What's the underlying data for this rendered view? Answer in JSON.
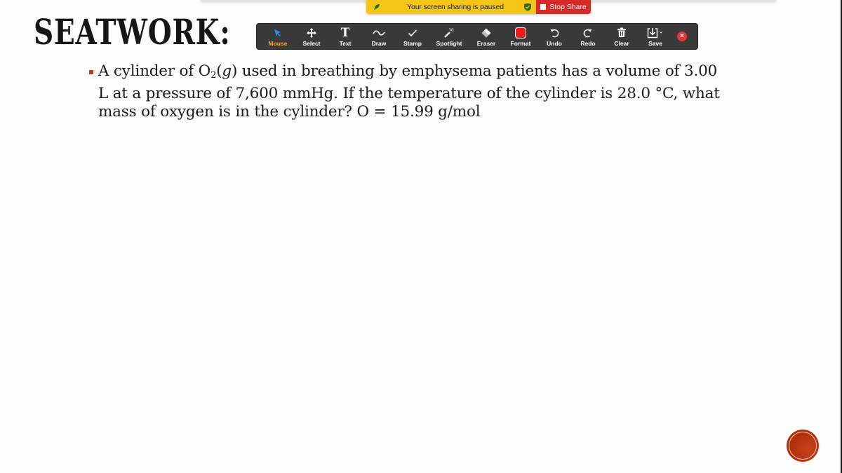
{
  "share_banner": {
    "status_text": "Your screen sharing is paused",
    "stop_label": "Stop Share",
    "status_color": "#f5c518",
    "stop_color": "#d92a2a"
  },
  "slide": {
    "title": "SEATWORK:",
    "question_lines": [
      {
        "pre": "A cylinder of O",
        "sub": "2",
        "mid": "(",
        "ital": "g",
        "post": ") used in breathing by emphysema patients has a volume of 3.00"
      },
      {
        "text": "L at a pressure of 7,600 mmHg. If the temperature of the cylinder is 28.0 °C, what"
      },
      {
        "text": "mass of oxygen is in the cylinder? O = 15.99 g/mol"
      }
    ],
    "bullet_color": "#b1411f",
    "accent_circle_color": "#b3300a"
  },
  "toolbar": {
    "tools": [
      {
        "id": "mouse",
        "label": "Mouse",
        "icon": "cursor-arrow-icon",
        "active": true
      },
      {
        "id": "select",
        "label": "Select",
        "icon": "move-arrows-icon",
        "active": false
      },
      {
        "id": "text",
        "label": "Text",
        "icon": "text-t-icon",
        "active": false
      },
      {
        "id": "draw",
        "label": "Draw",
        "icon": "squiggle-icon",
        "active": false
      },
      {
        "id": "stamp",
        "label": "Stamp",
        "icon": "checkmark-icon",
        "active": false
      },
      {
        "id": "spotlight",
        "label": "Spotlight",
        "icon": "magic-wand-icon",
        "active": false
      },
      {
        "id": "eraser",
        "label": "Eraser",
        "icon": "eraser-icon",
        "active": false
      },
      {
        "id": "format",
        "label": "Format",
        "icon": "color-swatch-icon",
        "active": false
      },
      {
        "id": "undo",
        "label": "Undo",
        "icon": "undo-icon",
        "active": false
      },
      {
        "id": "redo",
        "label": "Redo",
        "icon": "redo-icon",
        "active": false
      },
      {
        "id": "clear",
        "label": "Clear",
        "icon": "trash-icon",
        "active": false
      },
      {
        "id": "save",
        "label": "Save",
        "icon": "save-download-icon",
        "active": false
      }
    ],
    "active_label_color": "#f5a623",
    "format_color": "#ef1c1c",
    "close_color": "#e8333f",
    "close_glyph": "×"
  }
}
